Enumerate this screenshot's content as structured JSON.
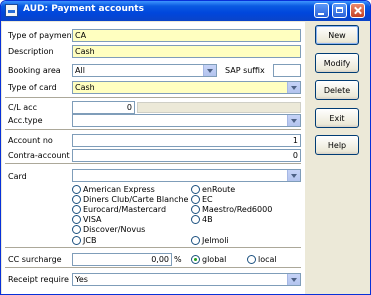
{
  "window": {
    "title": "AUD: Payment accounts"
  },
  "form": {
    "type_of_payment": {
      "label": "Type of payment",
      "value": "CA"
    },
    "description": {
      "label": "Description",
      "value": "Cash"
    },
    "booking_area": {
      "label": "Booking area",
      "value": "All"
    },
    "sap_suffix": {
      "label": "SAP suffix",
      "value": ""
    },
    "type_of_card": {
      "label": "Type of card",
      "value": "Cash"
    },
    "cl_acc": {
      "label": "C/L acc",
      "value": "0"
    },
    "acc_type": {
      "label": "Acc.type",
      "value": ""
    },
    "account_no": {
      "label": "Account no",
      "value": "1"
    },
    "contra_account": {
      "label": "Contra-account",
      "value": "0"
    },
    "card": {
      "label": "Card",
      "value": ""
    },
    "card_options_left": [
      "American Express",
      "Diners Club/Carte Blanche",
      "Eurocard/Mastercard",
      "VISA",
      "Discover/Novus",
      "JCB"
    ],
    "card_options_right": [
      "enRoute",
      "EC",
      "Maestro/Red6000",
      "4B",
      "Jelmoli"
    ],
    "cc_surcharge": {
      "label": "CC surcharge",
      "value": "0,00",
      "unit": "%"
    },
    "scope": {
      "global": "global",
      "local": "local",
      "selected": "global"
    },
    "receipt_required": {
      "label": "Receipt require",
      "value": "Yes"
    }
  },
  "buttons": {
    "new": "New",
    "modify": "Modify",
    "delete": "Delete",
    "exit": "Exit",
    "help": "Help"
  },
  "icons": {
    "window": "app-icon",
    "minimize": "minimize-icon",
    "maximize": "maximize-icon",
    "close": "close-icon",
    "dropdown": "chevron-down-icon"
  }
}
